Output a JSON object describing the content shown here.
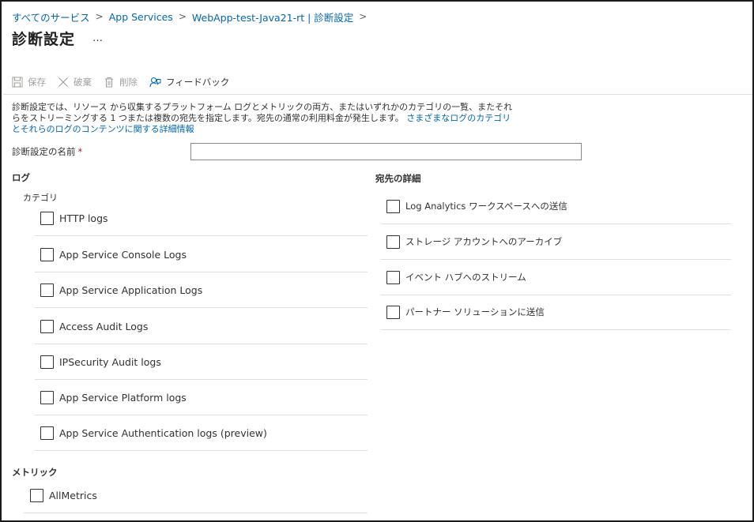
{
  "breadcrumb": [
    {
      "label": "すべてのサービス"
    },
    {
      "label": "App Services"
    },
    {
      "label": "WebApp-test-Java21-rt | 診断設定"
    }
  ],
  "breadcrumb_separator": ">",
  "page": {
    "title": "診断設定",
    "more": "…"
  },
  "toolbar": {
    "save": "保存",
    "discard": "破棄",
    "delete": "削除",
    "feedback": "フィードバック"
  },
  "description": {
    "text": "診断設定では、リソース から収集するプラットフォーム ログとメトリックの両方、またはいずれかのカテゴリの一覧、またそれらをストリーミングする 1 つまたは複数の宛先を指定します。宛先の通常の利用料金が発生します。",
    "link": "さまざまなログのカテゴリとそれらのログのコンテンツに関する詳細情報"
  },
  "name_field": {
    "label": "診断設定の名前",
    "required_mark": "*",
    "value": "",
    "placeholder": ""
  },
  "logs": {
    "heading": "ログ",
    "category_label": "カテゴリ",
    "items": [
      {
        "label": "HTTP logs",
        "checked": false
      },
      {
        "label": "App Service Console Logs",
        "checked": false
      },
      {
        "label": "App Service Application Logs",
        "checked": false
      },
      {
        "label": "Access Audit Logs",
        "checked": false
      },
      {
        "label": "IPSecurity Audit logs",
        "checked": false
      },
      {
        "label": "App Service Platform logs",
        "checked": false
      },
      {
        "label": "App Service Authentication logs (preview)",
        "checked": false
      }
    ]
  },
  "metrics": {
    "heading": "メトリック",
    "items": [
      {
        "label": "AllMetrics",
        "checked": false
      }
    ]
  },
  "destination": {
    "heading": "宛先の詳細",
    "items": [
      {
        "label": "Log Analytics ワークスペースへの送信",
        "checked": false
      },
      {
        "label": "ストレージ アカウントへのアーカイブ",
        "checked": false
      },
      {
        "label": "イベント ハブへのストリーム",
        "checked": false
      },
      {
        "label": "パートナー ソリューションに送信",
        "checked": false
      }
    ]
  },
  "colors": {
    "link": "#0067b8",
    "text": "#323130",
    "disabled": "#a19f9d",
    "divider": "#e1dfdd",
    "required": "#a4262c"
  },
  "icons": {
    "save": "save-icon",
    "discard": "close-icon",
    "delete": "trash-icon",
    "feedback": "feedback-icon"
  }
}
